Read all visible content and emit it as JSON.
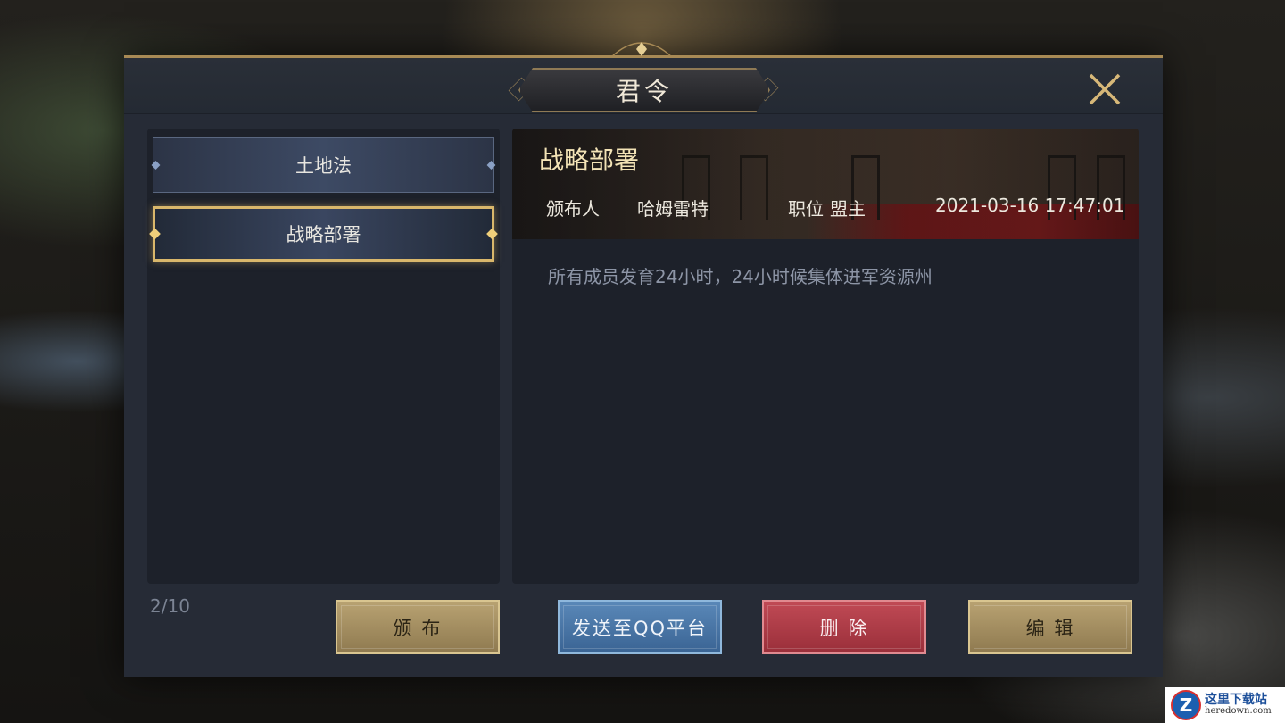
{
  "dialog": {
    "title": "君令",
    "close_icon": "close-icon"
  },
  "law_list": {
    "items": [
      {
        "label": "土地法",
        "selected": false
      },
      {
        "label": "战略部署",
        "selected": true
      }
    ],
    "page_count": "2/10"
  },
  "detail": {
    "title": "战略部署",
    "publisher_label": "颁布人",
    "publisher_name": "哈姆雷特",
    "position_label": "职位",
    "position_value": "盟主",
    "timestamp": "2021-03-16 17:47:01",
    "content": "所有成员发育24小时，24小时候集体进军资源州"
  },
  "buttons": {
    "publish": "颁 布",
    "send_qq": "发送至QQ平台",
    "delete": "删 除",
    "edit": "编 辑"
  },
  "watermark": {
    "cn": "这里下载站",
    "en": "heredown.com",
    "logo_letter": "Z"
  },
  "colors": {
    "accent_gold": "#d9b76b",
    "panel_bg": "#1d212a",
    "button_blue": "#4a78a8",
    "button_red": "#b03d48"
  }
}
